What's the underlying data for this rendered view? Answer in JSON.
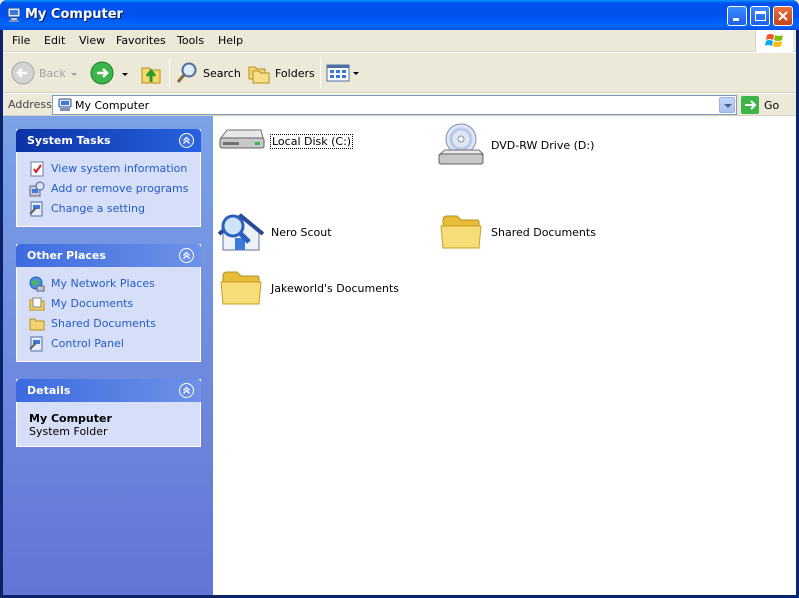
{
  "window": {
    "title": "My Computer"
  },
  "menu": {
    "items": [
      "File",
      "Edit",
      "View",
      "Favorites",
      "Tools",
      "Help"
    ]
  },
  "toolbar": {
    "back_label": "Back",
    "search_label": "Search",
    "folders_label": "Folders"
  },
  "address": {
    "label": "Address",
    "value": "My Computer",
    "go_label": "Go"
  },
  "sidebar": {
    "system_tasks": {
      "title": "System Tasks",
      "items": [
        {
          "label": "View system information",
          "icon": "system-info-icon"
        },
        {
          "label": "Add or remove programs",
          "icon": "add-remove-programs-icon"
        },
        {
          "label": "Change a setting",
          "icon": "control-panel-icon"
        }
      ]
    },
    "other_places": {
      "title": "Other Places",
      "items": [
        {
          "label": "My Network Places",
          "icon": "network-places-icon"
        },
        {
          "label": "My Documents",
          "icon": "my-documents-icon"
        },
        {
          "label": "Shared Documents",
          "icon": "folder-icon"
        },
        {
          "label": "Control Panel",
          "icon": "control-panel-icon"
        }
      ]
    },
    "details": {
      "title": "Details",
      "name": "My Computer",
      "type": "System Folder"
    }
  },
  "content": {
    "items": [
      {
        "label": "Local Disk (C:)",
        "icon": "hard-disk-icon"
      },
      {
        "label": "DVD-RW Drive (D:)",
        "icon": "dvd-drive-icon"
      },
      {
        "label": "Nero Scout",
        "icon": "nero-scout-icon"
      },
      {
        "label": "Shared Documents",
        "icon": "folder-icon"
      },
      {
        "label": "Jakeworld's Documents",
        "icon": "folder-icon"
      }
    ]
  },
  "colors": {
    "titlebar": "#0050ee",
    "sidebar_top": "#7ba2e7",
    "sidebar_bottom": "#6375d6",
    "link": "#215dc6"
  }
}
